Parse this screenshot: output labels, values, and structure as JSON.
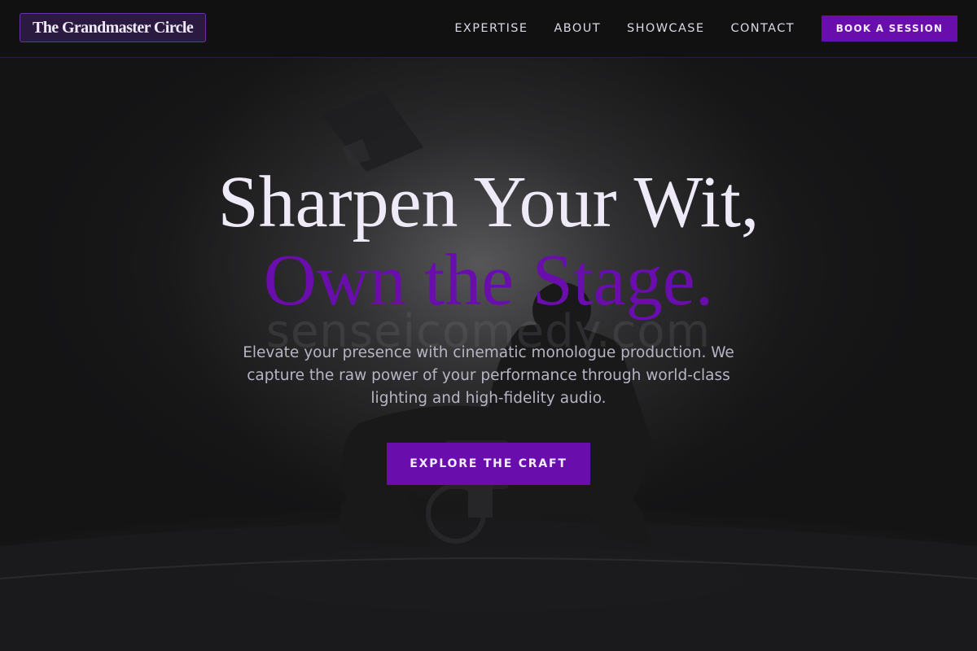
{
  "brand": {
    "name": "The Grandmaster Circle"
  },
  "nav": {
    "links": [
      "EXPERTISE",
      "ABOUT",
      "SHOWCASE",
      "CONTACT"
    ],
    "cta_label": "BOOK A SESSION"
  },
  "hero": {
    "headline_line1": "Sharpen Your Wit,",
    "headline_line2": "Own the Stage.",
    "watermark": "senseicomedy.com",
    "subtitle": "Elevate your presence with cinematic monologue production. We capture the raw power of your performance through world-class lighting and high-fidelity audio.",
    "cta_label": "EXPLORE THE CRAFT",
    "image_subject": "silhouette of a crouching camera operator on a dimly lit stage"
  },
  "colors": {
    "accent": "#6a0dad",
    "background": "#0f0f10",
    "headline": "#efeaf8",
    "subtitle": "#b9b4c4"
  }
}
